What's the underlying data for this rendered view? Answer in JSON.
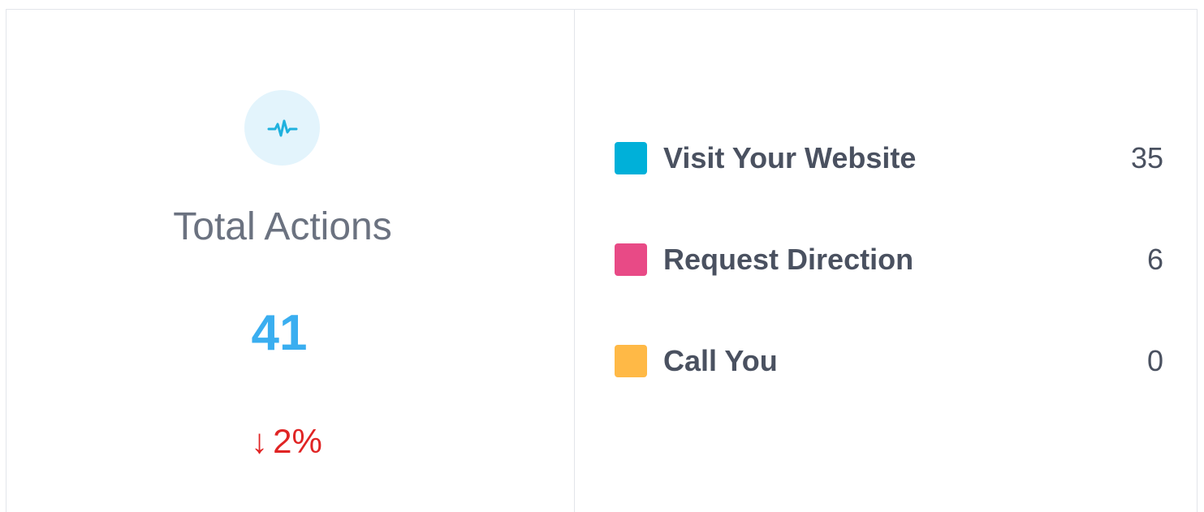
{
  "summary": {
    "icon": "activity-pulse-icon",
    "label": "Total Actions",
    "value": "41",
    "change_arrow": "↓",
    "change_text": "2%"
  },
  "legend": {
    "items": [
      {
        "label": "Visit Your Website",
        "count": "35",
        "color": "#00b0d9"
      },
      {
        "label": "Request Direction",
        "count": "6",
        "color": "#e84a86"
      },
      {
        "label": "Call You",
        "count": "0",
        "color": "#ffb946"
      }
    ]
  },
  "colors": {
    "accent_blue": "#3aaef0",
    "negative_red": "#e02424",
    "icon_bg": "#e3f4fc",
    "icon_stroke": "#1fb1de"
  }
}
